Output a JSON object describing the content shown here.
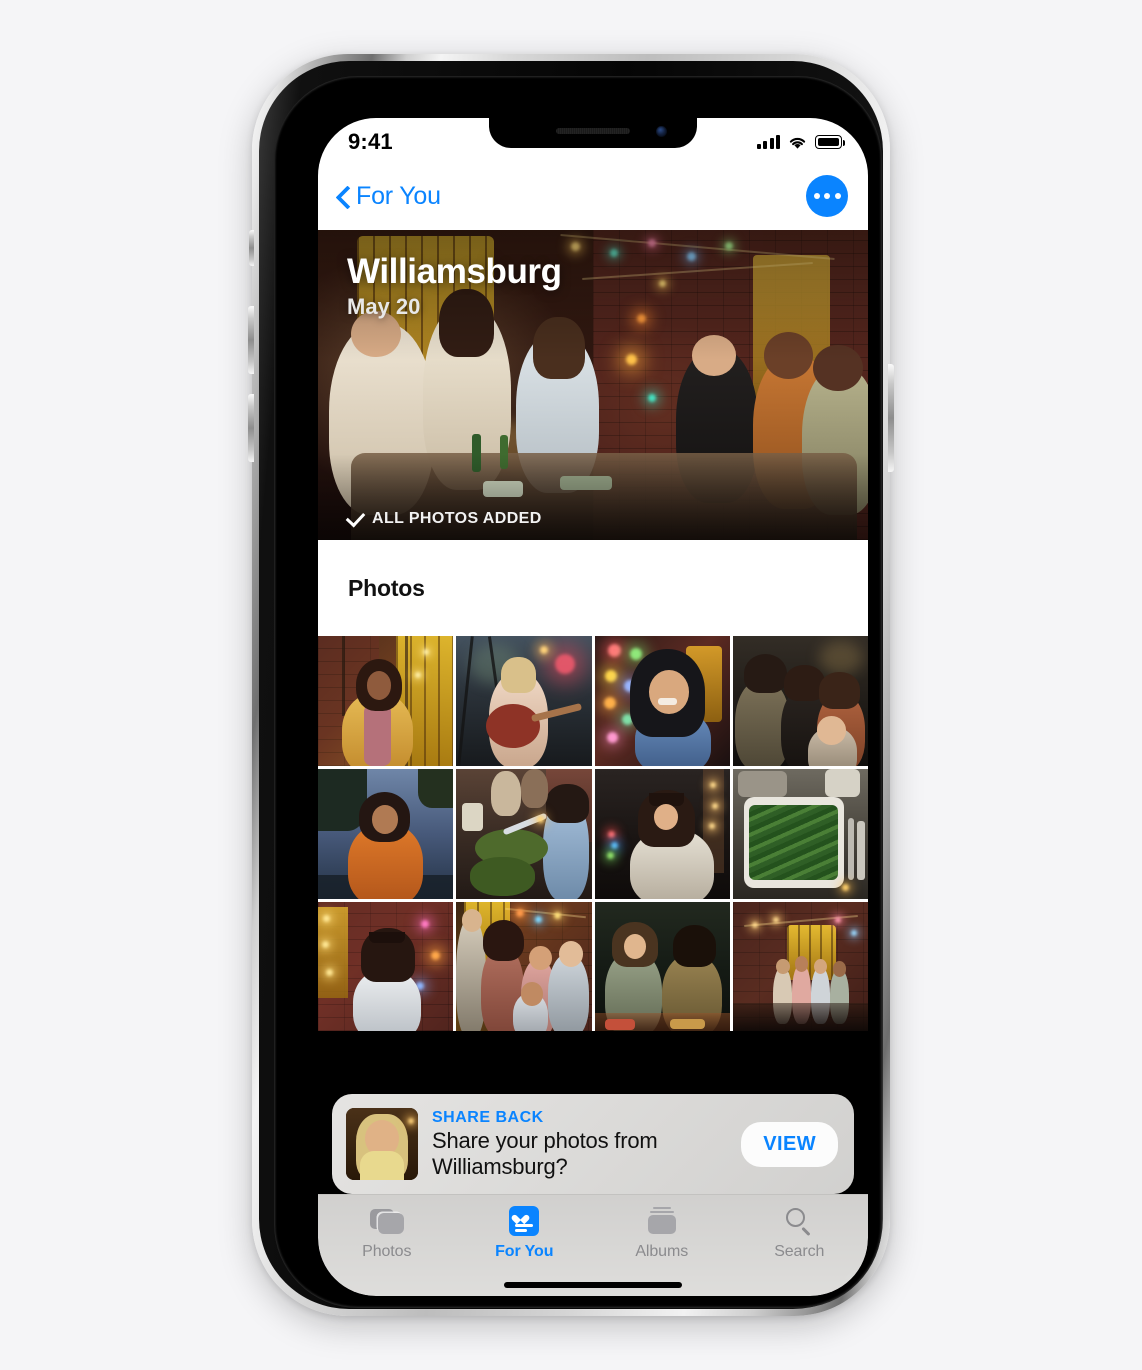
{
  "status_bar": {
    "time": "9:41",
    "cellular_icon": "signal-bars-icon",
    "wifi_icon": "wifi-icon",
    "battery_icon": "battery-full-icon"
  },
  "nav_bar": {
    "back_icon": "chevron-left-icon",
    "back_label": "For You",
    "more_button_icon": "ellipsis-icon",
    "accent_color": "#0a84ff"
  },
  "memory": {
    "title": "Williamsburg",
    "date": "May 20",
    "status_icon": "checkmark-icon",
    "status_label": "ALL PHOTOS ADDED"
  },
  "photos_section": {
    "title": "Photos",
    "items": [
      {
        "alt": "Woman laughing on a swing by string lights"
      },
      {
        "alt": "Man playing acoustic guitar outdoors at dusk"
      },
      {
        "alt": "Woman in a hood smiling with colorful bokeh lights"
      },
      {
        "alt": "Group of four friends posing together"
      },
      {
        "alt": "Woman in an orange shirt outdoors at blue hour"
      },
      {
        "alt": "Friends serving salad at a dinner table"
      },
      {
        "alt": "Woman with bangs in a white jacket"
      },
      {
        "alt": "Tray of green beans on a table"
      },
      {
        "alt": "Woman looking up at string lights on a brick wall"
      },
      {
        "alt": "Group of friends hugging and laughing"
      },
      {
        "alt": "Two friends talking at a backyard table"
      },
      {
        "alt": "Wide view of a backyard party with string lights"
      }
    ]
  },
  "banner": {
    "thumbnail_alt": "Portrait of a smiling man with long blond hair",
    "kicker": "SHARE BACK",
    "message": "Share your photos from Williamsburg?",
    "action_label": "VIEW",
    "kicker_color": "#0a84ff"
  },
  "tab_bar": {
    "tabs": [
      {
        "label": "Photos",
        "icon": "photos-stack-icon",
        "active": false
      },
      {
        "label": "For You",
        "icon": "for-you-card-icon",
        "active": true
      },
      {
        "label": "Albums",
        "icon": "albums-folder-icon",
        "active": false
      },
      {
        "label": "Search",
        "icon": "search-magnifier-icon",
        "active": false
      }
    ]
  }
}
